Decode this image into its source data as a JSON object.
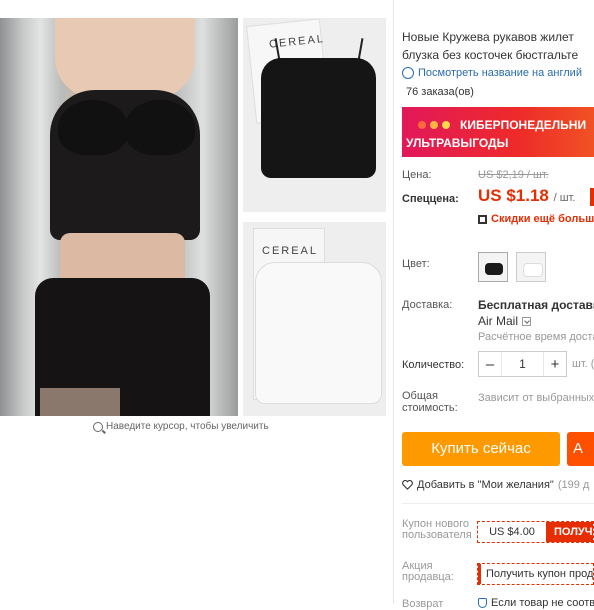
{
  "gallery": {
    "box_brand_1": "CEREAL",
    "box_brand_2": "CEREAL",
    "zoom_hint": "Наведите курсор, чтобы увеличить"
  },
  "product": {
    "title_line1": "Новые Кружева рукавов жилет",
    "title_line2": "блузка без косточек бюстгальте",
    "translate_link": "Посмотреть название на англий",
    "orders": "76 заказа(ов)"
  },
  "banner": {
    "line1": "КИБЕРПОНЕДЕЛЬНИ",
    "line2": "УЛЬТРАВЫГОДЫ",
    "dot_colors": [
      "#ff6a3d",
      "#ffb347",
      "#ffd84d"
    ]
  },
  "price": {
    "price_label": "Цена:",
    "old_price": "US $2,19 / шт.",
    "sale_label": "Спеццена:",
    "sale_price": "US $1.18",
    "sale_unit": "/ шт.",
    "coupon_note": "Скидки ещё больше"
  },
  "color": {
    "label": "Цвет:",
    "options": [
      "black",
      "white"
    ]
  },
  "shipping": {
    "label": "Доставка:",
    "main": "Бесплатная доставка к",
    "method": "Air Mail",
    "estimate": "Расчётное время достав"
  },
  "quantity": {
    "label": "Количество:",
    "minus": "–",
    "value": "1",
    "plus": "+",
    "unit": "шт. ("
  },
  "total": {
    "label_l1": "Общая",
    "label_l2": "стоимость:",
    "value": "Зависит от выбранных"
  },
  "actions": {
    "buy_now": "Купить сейчас",
    "add_to_cart": "A",
    "wishlist": "Добавить в \"Мои желания\"",
    "wishlist_count": "(199 д"
  },
  "coupon": {
    "label_l1": "Купон нового",
    "label_l2": "пользователя",
    "amount": "US $4.00",
    "get": "ПОЛУЧ"
  },
  "promo": {
    "label_l1": "Акция",
    "label_l2": "продавца:",
    "text": "Получить купон прод"
  },
  "returns": {
    "label": "Возврат",
    "text": "Если товар не соотв"
  },
  "colors": {
    "accent": "#e62e04",
    "buy": "#ff9900",
    "cart": "#ff5000",
    "link": "#2a6bb0"
  }
}
